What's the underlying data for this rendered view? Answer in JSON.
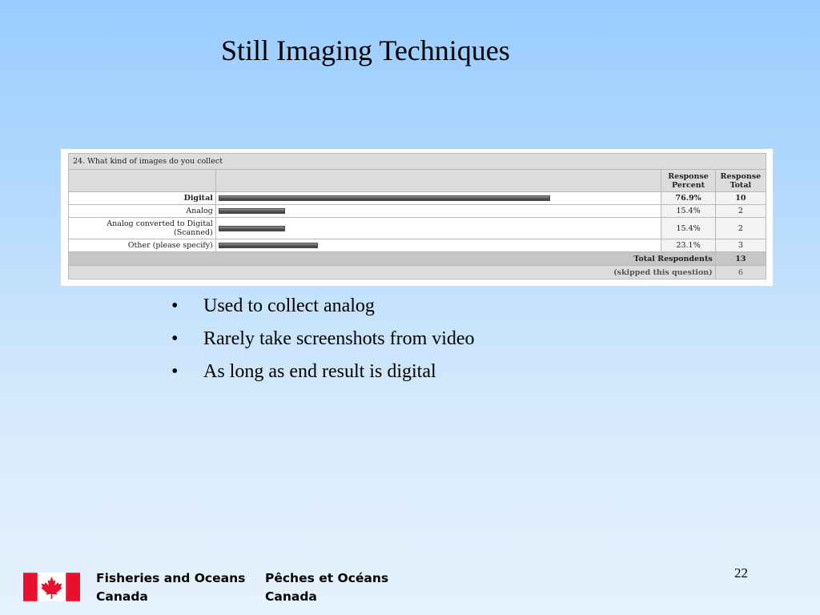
{
  "slide": {
    "title": "Still Imaging Techniques",
    "page_number": "22"
  },
  "survey": {
    "question": "24. What kind of images do you collect",
    "headers": {
      "percent": "Response Percent",
      "total": "Response Total"
    },
    "rows": [
      {
        "label": "Digital",
        "percent_text": "76.9%",
        "percent": 76.9,
        "total": "10"
      },
      {
        "label": "Analog",
        "percent_text": "15.4%",
        "percent": 15.4,
        "total": "2"
      },
      {
        "label": "Analog converted to Digital (Scanned)",
        "percent_text": "15.4%",
        "percent": 15.4,
        "total": "2"
      },
      {
        "label": "Other (please specify)",
        "percent_text": "23.1%",
        "percent": 23.1,
        "total": "3"
      }
    ],
    "total_respondents_label": "Total Respondents",
    "total_respondents": "13",
    "skipped_label": "(skipped this question)",
    "skipped": "6"
  },
  "bullets": [
    "Used to collect analog",
    "Rarely take screenshots from video",
    "As long as end result is digital"
  ],
  "footer": {
    "english_line1": "Fisheries and Oceans",
    "english_line2": "Canada",
    "french_line1": "Pêches et Océans",
    "french_line2": "Canada"
  },
  "colors": {
    "flag_red": "#e8112d",
    "background_top": "#99ccff",
    "background_bottom": "#e6f2fd"
  },
  "icons": {
    "flag": "canada-flag-icon"
  }
}
